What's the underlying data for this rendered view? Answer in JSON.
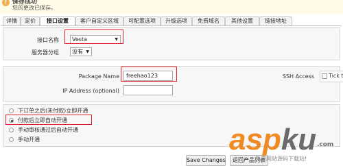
{
  "success": {
    "title": "保存成功",
    "message": "您的更改已保存。"
  },
  "tabs": [
    {
      "label": "详情"
    },
    {
      "label": "定价"
    },
    {
      "label": "接口设置"
    },
    {
      "label": "客户自定义区域"
    },
    {
      "label": "可配置选项"
    },
    {
      "label": "升级选项"
    },
    {
      "label": "免费域名"
    },
    {
      "label": "其他设置"
    },
    {
      "label": "链接地址"
    }
  ],
  "active_tab_index": 2,
  "module": {
    "name_label": "接口名称",
    "name_value": "Vesta",
    "group_label": "服务器分组",
    "group_value": "没有"
  },
  "module_settings": {
    "package_label": "Package Name",
    "package_value": "freehao123",
    "ip_label": "IP Address (optional)",
    "ip_value": "",
    "ssh_label": "SSH Access",
    "ssh_checkbox_text": "Tick to"
  },
  "setup_options": {
    "selected_index": 1,
    "items": [
      {
        "label": "下订单之后(未付款)立即开通"
      },
      {
        "label": "付款后立即自动开通"
      },
      {
        "label": "手动审核通过后自动开通"
      },
      {
        "label": "手动开通"
      }
    ]
  },
  "buttons": {
    "save": "Save Changes",
    "back": "返回产品列表"
  },
  "watermark": {
    "brand_a": "asp",
    "brand_b": "ku",
    "domain_suffix": ".com",
    "tagline": "免费网站源码下载站!"
  },
  "colors": {
    "highlight": "#e0202a",
    "brand_orange": "#f08a24"
  }
}
